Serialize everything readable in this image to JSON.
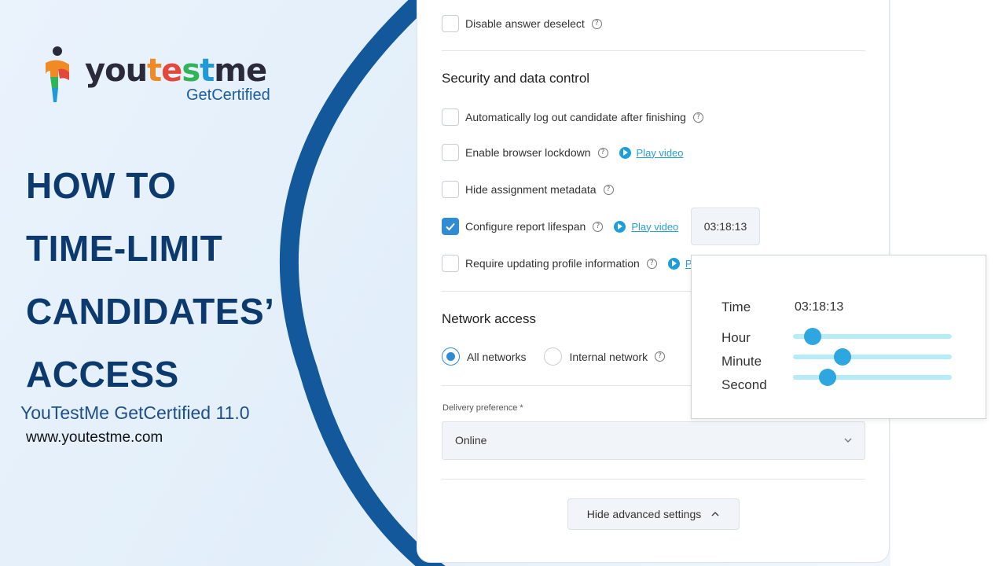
{
  "brand": {
    "logo_word": [
      "y",
      "o",
      "u",
      "t",
      "e",
      "s",
      "t",
      "m",
      "e"
    ],
    "logo_text": "youtestme",
    "logo_sub": "GetCertified",
    "headline": [
      "HOW TO",
      "TIME-LIMIT",
      "CANDIDATES’",
      "ACCESS"
    ],
    "product": "YouTestMe GetCertified 11.0",
    "website": "www.youtestme.com",
    "colors": {
      "navy": "#0d3a6e",
      "arc": "#12589b",
      "accent": "#2f8bd3"
    }
  },
  "settings": {
    "disable_answer_deselect": {
      "label": "Disable answer deselect",
      "checked": false
    },
    "security_title": "Security and data control",
    "auto_logout": {
      "label": "Automatically log out candidate after finishing",
      "checked": false
    },
    "browser_lockdown": {
      "label": "Enable browser lockdown",
      "checked": false,
      "video": "Play video"
    },
    "hide_metadata": {
      "label": "Hide assignment metadata",
      "checked": false
    },
    "report_lifespan": {
      "label": "Configure report lifespan",
      "checked": true,
      "video": "Play video",
      "time_value": "03:18:13"
    },
    "require_profile": {
      "label": "Require updating profile information",
      "checked": false,
      "video_partial": "Pl"
    },
    "network_title": "Network access",
    "network_options": [
      {
        "label": "All networks",
        "selected": true
      },
      {
        "label": "Internal network",
        "selected": false
      }
    ],
    "delivery_label": "Delivery preference *",
    "delivery_value": "Online",
    "advanced_button": "Hide advanced settings"
  },
  "time_picker": {
    "time_label": "Time",
    "time_value": "03:18:13",
    "hour_label": "Hour",
    "minute_label": "Minute",
    "second_label": "Second",
    "hour_fraction": 0.125,
    "minute_fraction": 0.31,
    "second_fraction": 0.22
  },
  "icons": [
    "help-icon",
    "play-icon",
    "chevron-down-icon",
    "chevron-up-icon",
    "checkmark-icon",
    "logo-person-icon"
  ]
}
